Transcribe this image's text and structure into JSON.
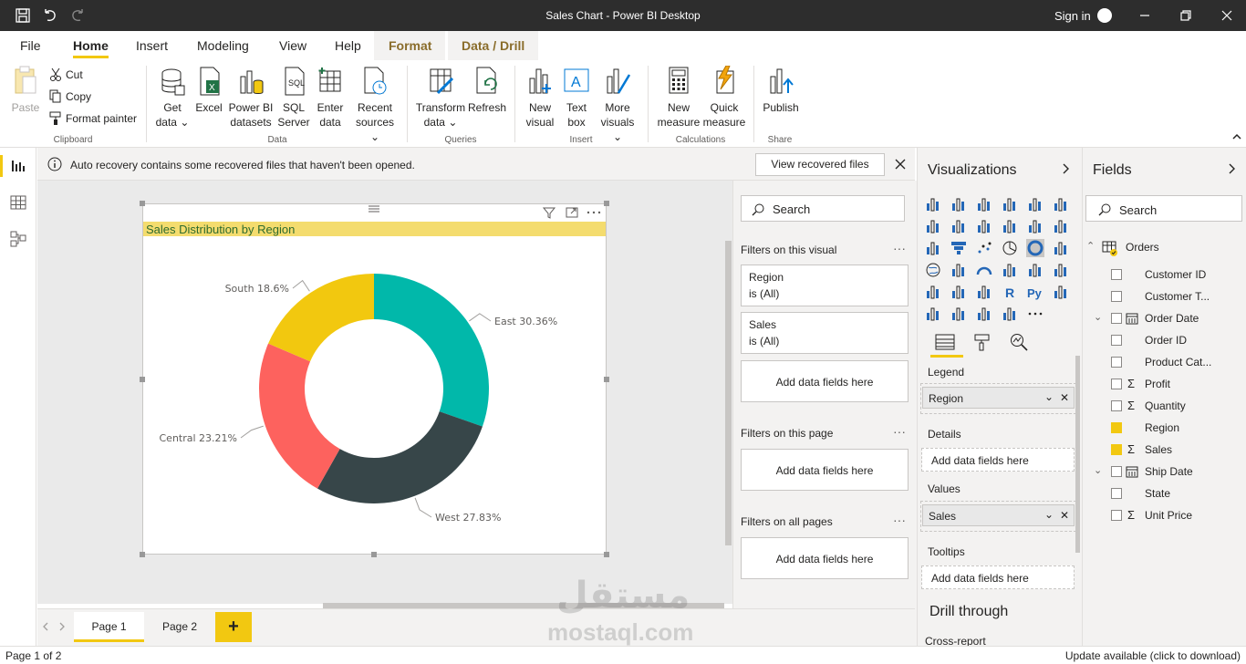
{
  "window": {
    "title": "Sales Chart - Power BI Desktop",
    "sign_in": "Sign in"
  },
  "tabs": {
    "file": "File",
    "home": "Home",
    "insert": "Insert",
    "modeling": "Modeling",
    "view": "View",
    "help": "Help",
    "format": "Format",
    "data_drill": "Data / Drill"
  },
  "ribbon": {
    "paste": "Paste",
    "cut": "Cut",
    "copy": "Copy",
    "format_painter": "Format painter",
    "clipboard": "Clipboard",
    "get_data_1": "Get",
    "get_data_2": "data",
    "excel": "Excel",
    "pbi_datasets_1": "Power BI",
    "pbi_datasets_2": "datasets",
    "sql_1": "SQL",
    "sql_2": "Server",
    "enter_1": "Enter",
    "enter_2": "data",
    "recent_1": "Recent",
    "recent_2": "sources",
    "data_group": "Data",
    "transform_1": "Transform",
    "transform_2": "data",
    "refresh": "Refresh",
    "queries_group": "Queries",
    "new_visual_1": "New",
    "new_visual_2": "visual",
    "text_box_1": "Text",
    "text_box_2": "box",
    "more_visuals_1": "More",
    "more_visuals_2": "visuals",
    "insert_group": "Insert",
    "new_measure_1": "New",
    "new_measure_2": "measure",
    "quick_measure_1": "Quick",
    "quick_measure_2": "measure",
    "calc_group": "Calculations",
    "publish": "Publish",
    "share_group": "Share"
  },
  "infobar": {
    "message": "Auto recovery contains some recovered files that haven't been opened.",
    "button": "View recovered files"
  },
  "visual": {
    "title": "Sales Distribution by Region"
  },
  "chart_data": {
    "type": "pie",
    "title": "Sales Distribution by Region",
    "donut": true,
    "categories": [
      "East",
      "West",
      "Central",
      "South"
    ],
    "values": [
      30.36,
      27.83,
      23.21,
      18.6
    ],
    "labels": [
      "East 30.36%",
      "West 27.83%",
      "Central 23.21%",
      "South 18.6%"
    ],
    "colors": [
      "#01b8aa",
      "#374649",
      "#fd625e",
      "#f2c80f"
    ]
  },
  "filters": {
    "search": "Search",
    "on_visual": "Filters on this visual",
    "region_name": "Region",
    "region_val": "is (All)",
    "sales_name": "Sales",
    "sales_val": "is (All)",
    "add_fields": "Add data fields here",
    "on_page": "Filters on this page",
    "on_all": "Filters on all pages",
    "dots": "···"
  },
  "viz": {
    "title": "Visualizations",
    "legend": "Legend",
    "legend_field": "Region",
    "details": "Details",
    "add_fields": "Add data fields here",
    "values": "Values",
    "values_field": "Sales",
    "tooltips": "Tooltips",
    "drill_through": "Drill through",
    "cross_report": "Cross-report"
  },
  "fields": {
    "title": "Fields",
    "search": "Search",
    "table": "Orders",
    "items": [
      {
        "name": "Customer ID",
        "checked": false,
        "sigma": false,
        "expand": false,
        "cal": false
      },
      {
        "name": "Customer T...",
        "checked": false,
        "sigma": false,
        "expand": false,
        "cal": false
      },
      {
        "name": "Order Date",
        "checked": false,
        "sigma": false,
        "expand": true,
        "cal": true
      },
      {
        "name": "Order ID",
        "checked": false,
        "sigma": false,
        "expand": false,
        "cal": false
      },
      {
        "name": "Product Cat...",
        "checked": false,
        "sigma": false,
        "expand": false,
        "cal": false
      },
      {
        "name": "Profit",
        "checked": false,
        "sigma": true,
        "expand": false,
        "cal": false
      },
      {
        "name": "Quantity",
        "checked": false,
        "sigma": true,
        "expand": false,
        "cal": false
      },
      {
        "name": "Region",
        "checked": true,
        "sigma": false,
        "expand": false,
        "cal": false
      },
      {
        "name": "Sales",
        "checked": true,
        "sigma": true,
        "expand": false,
        "cal": false
      },
      {
        "name": "Ship Date",
        "checked": false,
        "sigma": false,
        "expand": true,
        "cal": true
      },
      {
        "name": "State",
        "checked": false,
        "sigma": false,
        "expand": false,
        "cal": false
      },
      {
        "name": "Unit Price",
        "checked": false,
        "sigma": true,
        "expand": false,
        "cal": false
      }
    ]
  },
  "pages": {
    "page1": "Page 1",
    "page2": "Page 2",
    "add": "+"
  },
  "status": {
    "left": "Page 1 of 2",
    "right": "Update available (click to download)"
  },
  "watermark": {
    "arabic": "مستقل",
    "latin": "mostaql.com"
  }
}
